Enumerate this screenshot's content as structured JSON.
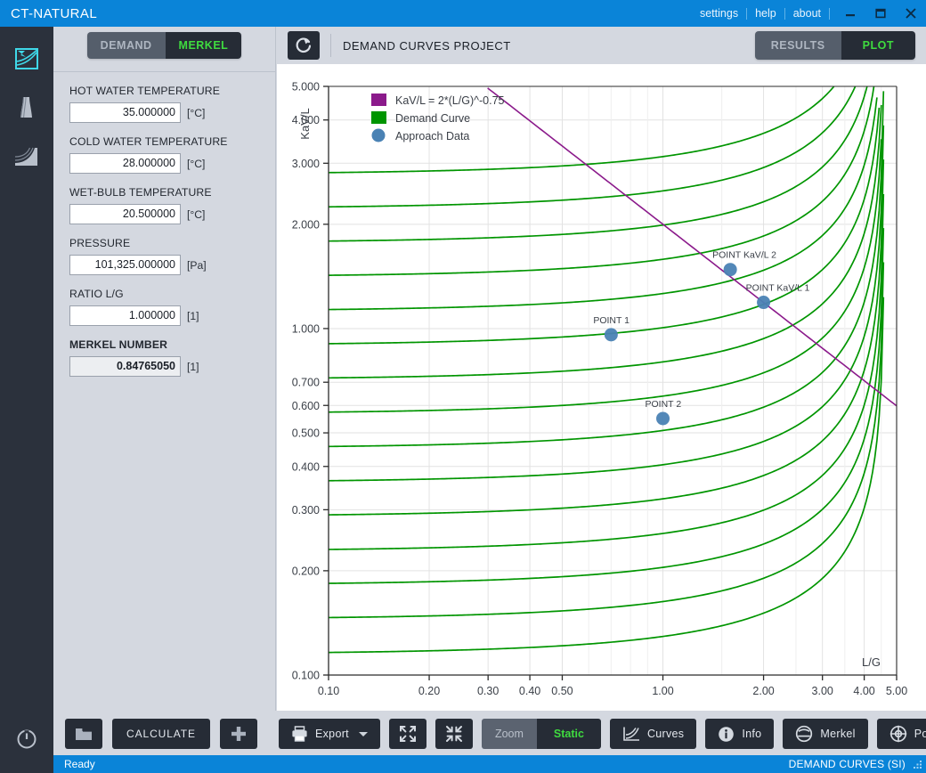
{
  "window": {
    "app_title": "CT-NATURAL",
    "menu": [
      "settings",
      "help",
      "about"
    ],
    "controls": {
      "minimize": "minimize-icon",
      "maximize": "maximize-icon",
      "close": "close-icon"
    }
  },
  "rail": {
    "items": [
      {
        "name": "demand-curves",
        "icon": "demand-curves-icon",
        "active": true
      },
      {
        "name": "cooling-tower",
        "icon": "cooling-tower-icon",
        "active": false
      },
      {
        "name": "performance-curves",
        "icon": "performance-curves-icon",
        "active": false
      }
    ],
    "power": "power-icon"
  },
  "left_panel": {
    "mode_toggle": {
      "left_label": "DEMAND",
      "right_label": "MERKEL",
      "selected": "MERKEL"
    },
    "fields": [
      {
        "label": "HOT WATER TEMPERATURE",
        "value": "35.000000",
        "unit": "[°C]",
        "readonly": false
      },
      {
        "label": "COLD WATER TEMPERATURE",
        "value": "28.000000",
        "unit": "[°C]",
        "readonly": false
      },
      {
        "label": "WET-BULB TEMPERATURE",
        "value": "20.500000",
        "unit": "[°C]",
        "readonly": false
      },
      {
        "label": "PRESSURE",
        "value": "101,325.000000",
        "unit": "[Pa]",
        "readonly": false
      },
      {
        "label": "RATIO L/G",
        "value": "1.000000",
        "unit": "[1]",
        "readonly": false
      },
      {
        "label": "MERKEL NUMBER",
        "value": "0.84765050",
        "unit": "[1]",
        "readonly": true
      }
    ]
  },
  "main_header": {
    "refresh_icon": "refresh-icon",
    "title": "DEMAND CURVES PROJECT",
    "view_toggle": {
      "left_label": "RESULTS",
      "right_label": "PLOT",
      "selected": "PLOT"
    }
  },
  "toolbar": {
    "open_label": "",
    "calculate_label": "CALCULATE",
    "add_label": "",
    "export_label": "Export",
    "expand_label": "",
    "collapse_label": "",
    "zoom_toggle": {
      "left_label": "Zoom",
      "right_label": "Static",
      "selected": "Static"
    },
    "curves_label": "Curves",
    "info_label": "Info",
    "merkel_label": "Merkel",
    "point_label": "Point"
  },
  "statusbar": {
    "message": "Ready",
    "project": "DEMAND CURVES (SI)"
  },
  "chart_data": {
    "type": "line",
    "title": "",
    "xlabel": "L/G",
    "ylabel": "KaV/L",
    "xscale": "log",
    "yscale": "log",
    "xlim": [
      0.1,
      5.0
    ],
    "ylim": [
      0.1,
      5.0
    ],
    "xticks": [
      "0.10",
      "0.20",
      "0.30",
      "0.40",
      "0.50",
      "1.00",
      "2.00",
      "3.00",
      "4.00",
      "5.00"
    ],
    "xtick_values": [
      0.1,
      0.2,
      0.3,
      0.4,
      0.5,
      1.0,
      2.0,
      3.0,
      4.0,
      5.0
    ],
    "yticks": [
      "5.000",
      "4.000",
      "3.000",
      "2.000",
      "1.000",
      "0.700",
      "0.600",
      "0.500",
      "0.400",
      "0.300",
      "0.200",
      "0.100"
    ],
    "ytick_values": [
      5.0,
      4.0,
      3.0,
      2.0,
      1.0,
      0.7,
      0.6,
      0.5,
      0.4,
      0.3,
      0.2,
      0.1
    ],
    "grid": true,
    "legend_position": "top-left",
    "legend": [
      {
        "label": "KaV/L = 2*(L/G)^-0.75",
        "color": "#8B1A8B",
        "marker": "square"
      },
      {
        "label": "Demand Curve",
        "color": "#009500",
        "marker": "square"
      },
      {
        "label": "Approach Data",
        "color": "#4a82b4",
        "marker": "circle"
      }
    ],
    "series": [
      {
        "name": "KaV/L = 2*(L/G)^-0.75",
        "color": "#8B1A8B",
        "type": "power",
        "coefficient": 2.0,
        "exponent": -0.75,
        "x_start": 0.1,
        "x_end": 5.0
      },
      {
        "name": "Demand Curve",
        "color": "#009500",
        "type": "family",
        "description": "Family of cooling-tower demand curves, flat at low L/G and rising steeply near high L/G",
        "curve_scales": [
          0.115,
          0.145,
          0.182,
          0.228,
          0.287,
          0.36,
          0.452,
          0.568,
          0.713,
          0.895,
          1.123,
          1.41,
          1.77,
          2.222,
          2.79
        ],
        "knee": 4.6,
        "steepness": 2.1
      }
    ],
    "points": [
      {
        "label": "POINT 1",
        "x": 0.7,
        "y": 0.96,
        "color": "#4a82b4"
      },
      {
        "label": "POINT 2",
        "x": 1.0,
        "y": 0.55,
        "color": "#4a82b4"
      },
      {
        "label": "POINT KaV/L 1",
        "x": 2.0,
        "y": 1.19,
        "color": "#4a82b4"
      },
      {
        "label": "POINT KaV/L 2",
        "x": 1.59,
        "y": 1.48,
        "color": "#4a82b4"
      }
    ]
  }
}
